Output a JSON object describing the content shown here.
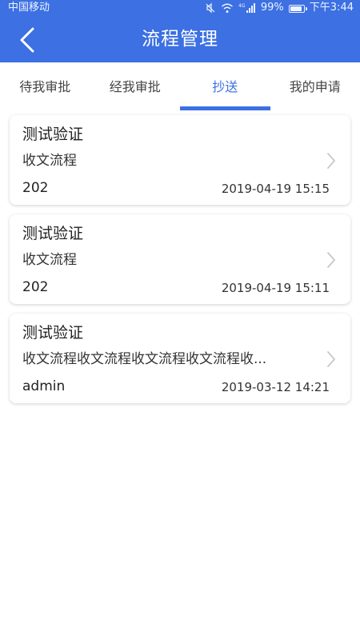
{
  "status_bar": {
    "carrier": "中国移动",
    "network": "4G",
    "battery": "99%",
    "time": "下午3:44",
    "battery_level": 0.99
  },
  "header": {
    "title": "流程管理",
    "back_icon": "chevron-left-icon"
  },
  "tabs": [
    {
      "label": "待我审批",
      "active": false
    },
    {
      "label": "经我审批",
      "active": false
    },
    {
      "label": "抄送",
      "active": true
    },
    {
      "label": "我的申请",
      "active": false
    }
  ],
  "cards": [
    {
      "title": "测试验证",
      "subtitle": "收文流程",
      "user": "202",
      "date": "2019-04-19 15:15"
    },
    {
      "title": "测试验证",
      "subtitle": "收文流程",
      "user": "202",
      "date": "2019-04-19 15:11"
    },
    {
      "title": "测试验证",
      "subtitle": "收文流程收文流程收文流程收文流程收...",
      "user": "admin",
      "date": "2019-03-12 14:21"
    }
  ],
  "colors": {
    "accent": "#3c70e3",
    "text_primary": "#222222",
    "text_secondary": "#333333",
    "chevron": "#c8c8c8"
  }
}
